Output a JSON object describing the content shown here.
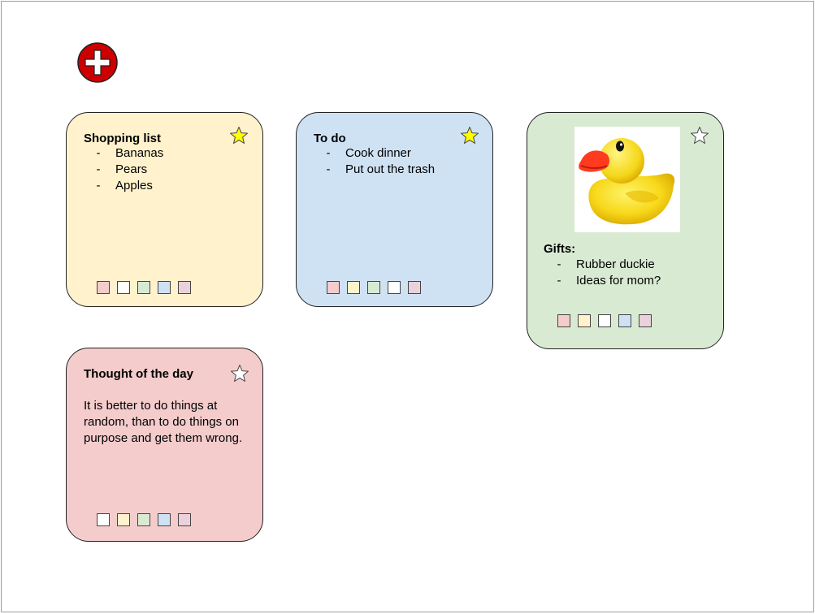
{
  "add_button": {
    "icon": "plus-circle-icon",
    "color": "#cc0000"
  },
  "colors": {
    "yellow": "#fff2cc",
    "blue": "#cfe2f3",
    "green": "#d9ead3",
    "red": "#f4cccc",
    "white": "#ffffff",
    "star_active": "#ffff00",
    "star_inactive": "#ffffff",
    "swatch_pink": "#f4cccc",
    "swatch_yellow": "#fff2cc",
    "swatch_green": "#d9ead3",
    "swatch_blue": "#cfe2f3",
    "swatch_lilac": "#ead1dc"
  },
  "notes": [
    {
      "id": "shopping-list",
      "title": "Shopping list",
      "starred": true,
      "bg_color": "#fff2cc",
      "items": [
        "Bananas",
        "Pears",
        "Apples"
      ],
      "swatches": [
        "#f4cccc",
        "#ffffff",
        "#d9ead3",
        "#cfe2f3",
        "#ead1dc"
      ]
    },
    {
      "id": "to-do",
      "title": "To do",
      "starred": true,
      "bg_color": "#cfe2f3",
      "items": [
        "Cook dinner",
        "Put out the trash"
      ],
      "swatches": [
        "#f4cccc",
        "#fff2cc",
        "#d9ead3",
        "#ffffff",
        "#ead1dc"
      ]
    },
    {
      "id": "gifts",
      "title": "Gifts:",
      "starred": false,
      "bg_color": "#d9ead3",
      "image": "rubber-duck-image",
      "items": [
        "Rubber duckie",
        "Ideas for mom?"
      ],
      "swatches": [
        "#f4cccc",
        "#fff2cc",
        "#ffffff",
        "#cfe2f3",
        "#ead1dc"
      ]
    },
    {
      "id": "thought-of-the-day",
      "title": "Thought of the day",
      "starred": false,
      "bg_color": "#f4cccc",
      "body": "It is better to do things at random, than to do things on purpose and get them wrong.",
      "swatches": [
        "#ffffff",
        "#fff2cc",
        "#d9ead3",
        "#cfe2f3",
        "#ead1dc"
      ]
    }
  ],
  "list_bullet": "-"
}
